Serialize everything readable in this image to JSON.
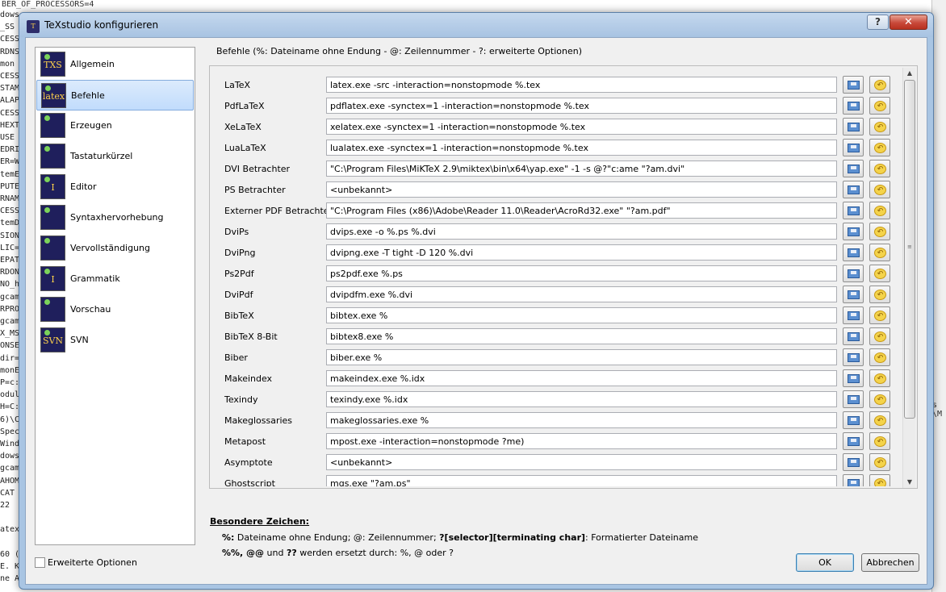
{
  "background": {
    "top_text": "BER_OF_PROCESSORS=4",
    "left_lines": [
      "dows",
      "_SS",
      "CESS",
      "RDNS",
      "mon",
      "CESS",
      "STAM",
      "ALAP",
      "CESS",
      "HEXT",
      "USE",
      "EDRI",
      "ER=W",
      "temE",
      "PUTE",
      "RNAM",
      "CESS",
      "temD",
      "SION",
      "LIC=",
      "EPAT",
      "RDON",
      "NO_h",
      "gcam",
      "RPRO",
      "gcam",
      "X_MS",
      "ONSE",
      "dir=",
      "monE",
      "P=c:",
      "odul",
      "H=C:",
      "6)\\C",
      "Spec",
      "Wind",
      "dows",
      "gcam",
      "AHOM",
      "CAT",
      "22",
      "",
      "atex",
      "",
      "60 (1",
      "E. Kn",
      "ne Ar"
    ],
    "right_text": "s \\M"
  },
  "dialog": {
    "title": "TeXstudio konfigurieren",
    "help_label": "?",
    "close_label": "✕",
    "app_icon": "texstudio-icon"
  },
  "sidebar": {
    "items": [
      {
        "label": "Allgemein",
        "icon": "TXS"
      },
      {
        "label": "Befehle",
        "icon": "latex",
        "selected": true
      },
      {
        "label": "Erzeugen",
        "icon": ""
      },
      {
        "label": "Tastaturkürzel",
        "icon": ""
      },
      {
        "label": "Editor",
        "icon": "I"
      },
      {
        "label": "Syntaxhervorhebung",
        "icon": ""
      },
      {
        "label": "Vervollständigung",
        "icon": ""
      },
      {
        "label": "Grammatik",
        "icon": "I"
      },
      {
        "label": "Vorschau",
        "icon": ""
      },
      {
        "label": "SVN",
        "icon": "SVN"
      }
    ],
    "extended_options_label": "Erweiterte Optionen"
  },
  "commands": {
    "group_title": "Befehle (%: Dateiname ohne Endung - @: Zeilennummer - ?: erweiterte Optionen)",
    "rows": [
      {
        "label": "LaTeX",
        "value": "latex.exe -src -interaction=nonstopmode %.tex"
      },
      {
        "label": "PdfLaTeX",
        "value": "pdflatex.exe -synctex=1 -interaction=nonstopmode %.tex"
      },
      {
        "label": "XeLaTeX",
        "value": "xelatex.exe -synctex=1 -interaction=nonstopmode %.tex"
      },
      {
        "label": "LuaLaTeX",
        "value": "lualatex.exe -synctex=1 -interaction=nonstopmode %.tex"
      },
      {
        "label": "DVI Betrachter",
        "value": "\"C:\\Program Files\\MiKTeX 2.9\\miktex\\bin\\x64\\yap.exe\" -1 -s @?\"c:ame \"?am.dvi\""
      },
      {
        "label": "PS Betrachter",
        "value": "<unbekannt>"
      },
      {
        "label": "Externer PDF Betrachter",
        "value": "\"C:\\Program Files (x86)\\Adobe\\Reader 11.0\\Reader\\AcroRd32.exe\" \"?am.pdf\""
      },
      {
        "label": "DviPs",
        "value": "dvips.exe -o %.ps %.dvi"
      },
      {
        "label": "DviPng",
        "value": "dvipng.exe -T tight -D 120 %.dvi"
      },
      {
        "label": "Ps2Pdf",
        "value": "ps2pdf.exe %.ps"
      },
      {
        "label": "DviPdf",
        "value": "dvipdfm.exe %.dvi"
      },
      {
        "label": "BibTeX",
        "value": "bibtex.exe %"
      },
      {
        "label": "BibTeX 8-Bit",
        "value": "bibtex8.exe %"
      },
      {
        "label": "Biber",
        "value": "biber.exe %"
      },
      {
        "label": "Makeindex",
        "value": "makeindex.exe %.idx"
      },
      {
        "label": "Texindy",
        "value": "texindy.exe %.idx"
      },
      {
        "label": "Makeglossaries",
        "value": "makeglossaries.exe %"
      },
      {
        "label": "Metapost",
        "value": "mpost.exe -interaction=nonstopmode ?me)"
      },
      {
        "label": "Asymptote",
        "value": "<unbekannt>"
      },
      {
        "label": "Ghostscript",
        "value": "mgs.exe \"?am.ps\""
      }
    ],
    "scroll_up": "▲",
    "scroll_down": "▼"
  },
  "special": {
    "heading": "Besondere Zeichen:",
    "line1_a": "%:",
    "line1_b": " Dateiname ohne Endung; @: Zeilennummer; ",
    "line1_c": "?[selector][terminating char]",
    "line1_d": ": Formatierter Dateiname",
    "line2_a": "%%, @@",
    "line2_b": " und ",
    "line2_c": "??",
    "line2_d": " werden ersetzt durch: %, @ oder ?"
  },
  "buttons": {
    "ok": "OK",
    "cancel": "Abbrechen"
  }
}
